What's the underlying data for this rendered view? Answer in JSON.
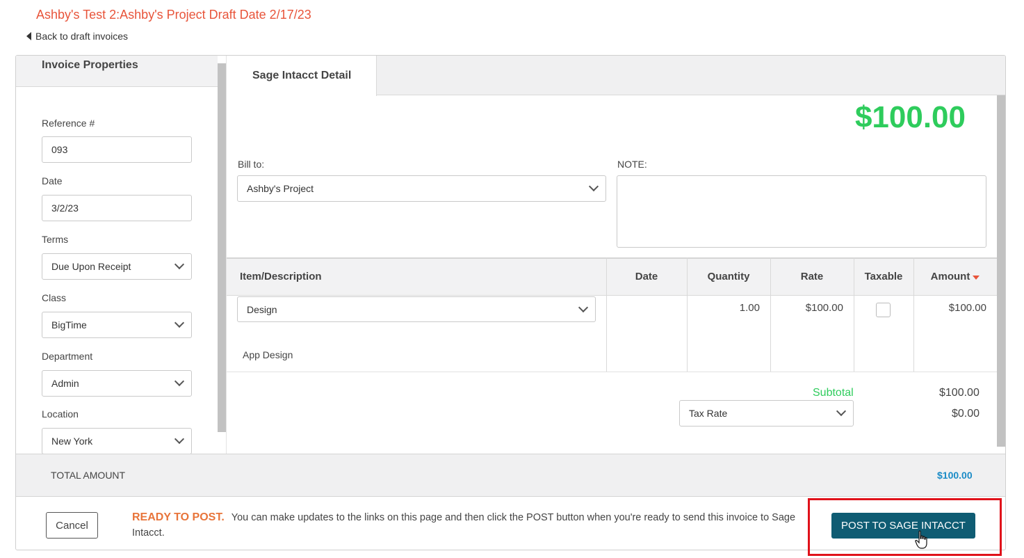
{
  "page": {
    "title": "Ashby's Test 2:Ashby's Project Draft Date 2/17/23",
    "back_link": "Back to draft invoices"
  },
  "sidebar": {
    "heading": "Invoice Properties",
    "reference": {
      "label": "Reference #",
      "value": "093"
    },
    "date": {
      "label": "Date",
      "value": "3/2/23"
    },
    "terms": {
      "label": "Terms",
      "value": "Due Upon Receipt"
    },
    "class": {
      "label": "Class",
      "value": "BigTime"
    },
    "department": {
      "label": "Department",
      "value": "Admin"
    },
    "location": {
      "label": "Location",
      "value": "New York"
    }
  },
  "tab": {
    "label": "Sage Intacct Detail"
  },
  "detail": {
    "total_display": "$100.00",
    "bill_to_label": "Bill to:",
    "bill_to_value": "Ashby's Project",
    "note_label": "NOTE:",
    "note_value": ""
  },
  "table": {
    "headers": {
      "item": "Item/Description",
      "date": "Date",
      "quantity": "Quantity",
      "rate": "Rate",
      "taxable": "Taxable",
      "amount": "Amount"
    },
    "rows": [
      {
        "item": "Design",
        "description": "App Design",
        "date": "",
        "quantity": "1.00",
        "rate": "$100.00",
        "taxable": false,
        "amount": "$100.00"
      }
    ]
  },
  "summary": {
    "subtotal_label": "Subtotal",
    "subtotal_value": "$100.00",
    "tax_rate_value": "Tax Rate",
    "tax_value": "$0.00"
  },
  "total_bar": {
    "label": "TOTAL AMOUNT",
    "value": "$100.00"
  },
  "footer": {
    "cancel_label": "Cancel",
    "ready_label": "READY TO POST.",
    "ready_text": "You can make updates to the links on this page and then click the POST button when you're ready to send this invoice to Sage Intacct.",
    "post_label": "POST TO SAGE INTACCT"
  },
  "colors": {
    "title": "#e8543a",
    "amount_green": "#2ecc5c",
    "total_blue": "#1a8bc6",
    "post_button": "#0f5c73",
    "highlight_red": "#e0111a"
  }
}
